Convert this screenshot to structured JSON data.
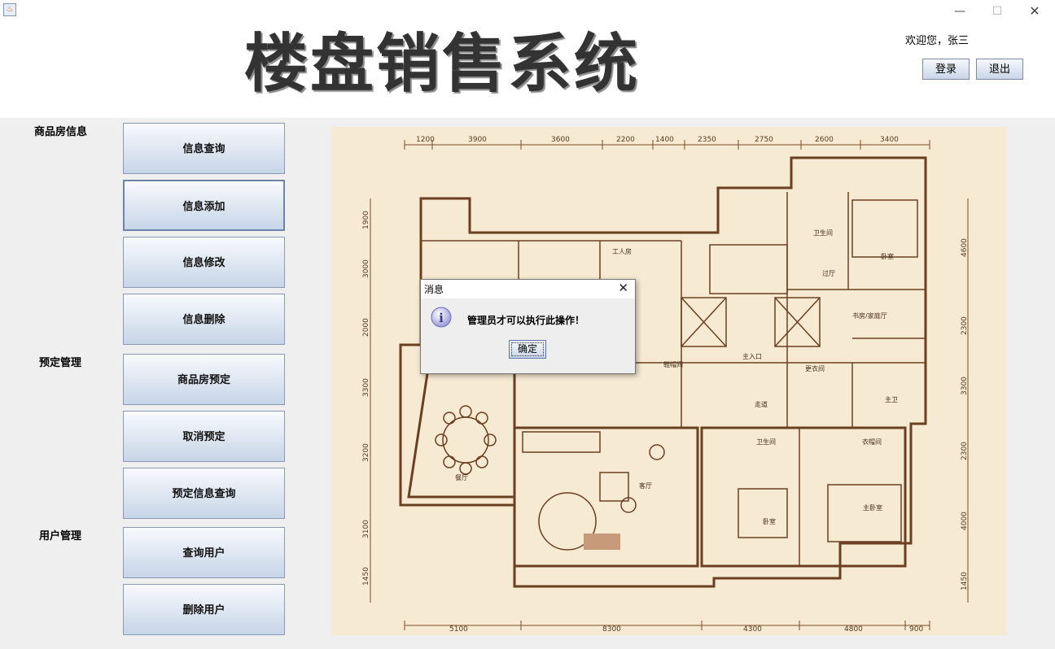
{
  "window": {
    "icon": "java-icon",
    "minimize_glyph": "—",
    "maximize_glyph": "☐",
    "close_glyph": "✕"
  },
  "header": {
    "title": "楼盘销售系统",
    "welcome": "欢迎您，张三",
    "login_label": "登录",
    "exit_label": "退出"
  },
  "sidebar": {
    "sections": [
      {
        "label": "商品房信息",
        "items": [
          "信息查询",
          "信息添加",
          "信息修改",
          "信息删除"
        ]
      },
      {
        "label": "预定管理",
        "items": [
          "商品房预定",
          "取消预定",
          "预定信息查询"
        ]
      },
      {
        "label": "用户管理",
        "items": [
          "查询用户",
          "删除用户"
        ]
      }
    ]
  },
  "floorplan": {
    "top_dims": [
      "1200",
      "3900",
      "3600",
      "2200",
      "1400",
      "2350",
      "2750",
      "2600",
      "3400"
    ],
    "bottom_dims": [
      "5100",
      "8300",
      "4300",
      "4800",
      "900"
    ],
    "left_dims": [
      "1900",
      "3000",
      "2000",
      "3300",
      "3200",
      "3100",
      "1450"
    ],
    "right_dims": [
      "4600",
      "2300",
      "3300",
      "2300",
      "4000",
      "1450"
    ],
    "rooms": [
      "工人房",
      "卫生间",
      "卧室",
      "过厅",
      "书房/家庭厅",
      "主入口",
      "鞋帽间",
      "更衣间",
      "走道",
      "主卫",
      "卫生间",
      "衣帽间",
      "餐厅",
      "客厅",
      "卧室",
      "主卧室"
    ]
  },
  "dialog": {
    "title": "消息",
    "message": "管理员才可以执行此操作！",
    "ok_label": "确定",
    "icon": "info-icon"
  },
  "colors": {
    "title_text": "#333333",
    "panel_bg": "#efefef",
    "floorplan_bg": "#f6ead2",
    "floorplan_line": "#7a4a28",
    "button_gradient_top": "#f8fafd",
    "button_gradient_bottom": "#c6d5e8"
  }
}
